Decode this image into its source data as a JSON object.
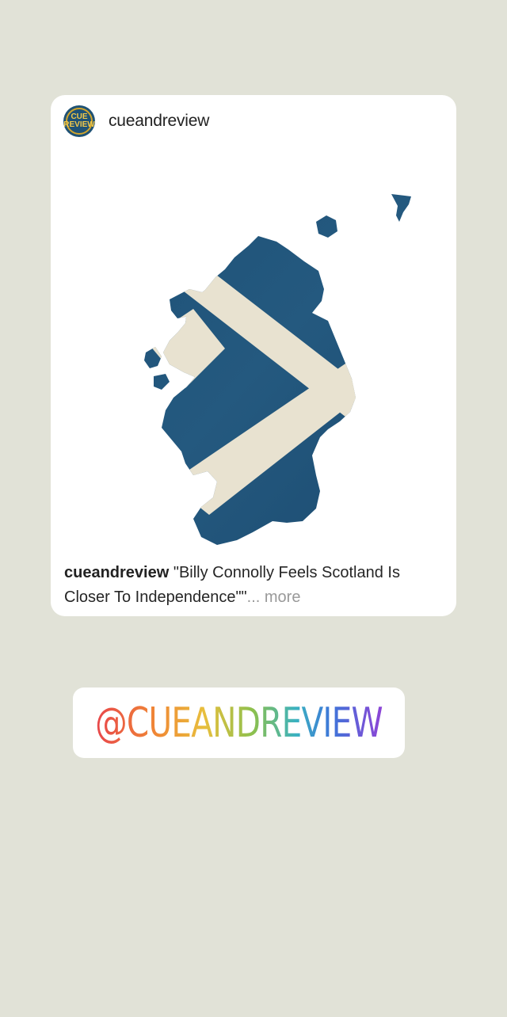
{
  "post": {
    "username": "cueandreview",
    "avatar_text": "CUE REVIEW",
    "caption_user": "cueandreview",
    "caption_text": " \"Billy Connolly Feels Scotland Is Closer To Independence\"\"",
    "more_label": "... more",
    "image_icon": "scotland-flag-map",
    "colors": {
      "flag_blue": "#1f5275",
      "flag_white": "#e8e2d0",
      "avatar_gold": "#d1a52d"
    }
  },
  "mention": {
    "text": "@CUEANDREVIEW"
  }
}
